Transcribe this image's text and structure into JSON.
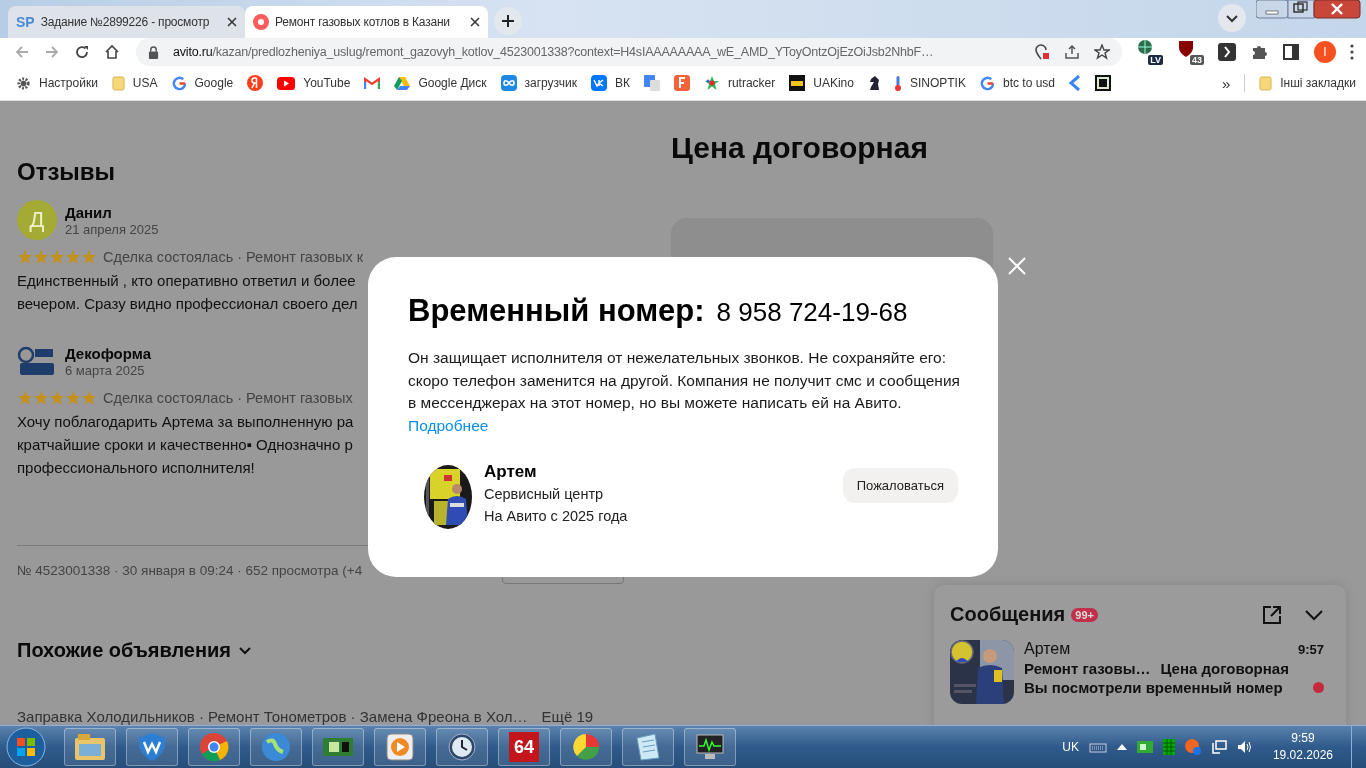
{
  "browser": {
    "tabs": [
      {
        "favicon_text": "SP",
        "title": "Задание №2899226 - просмотр",
        "selected": false
      },
      {
        "title": "Ремонт газовых котлов в Казани",
        "selected": true
      }
    ],
    "address": {
      "host": "avito.ru",
      "path": "/kazan/predlozheniya_uslug/remont_gazovyh_kotlov_4523001338?context=H4sIAAAAAAAA_wE_AMD_YToyOntzOjEzOiJsb2NhbF…"
    },
    "extensions": [
      {
        "kind": "globe",
        "badge": "LV"
      },
      {
        "kind": "shield",
        "badge": "43"
      },
      {
        "kind": "bracket"
      },
      {
        "kind": "puzzle"
      },
      {
        "kind": "sidebar"
      }
    ],
    "profile": "I",
    "bookmarks": [
      {
        "kind": "gear",
        "label": "Настройки"
      },
      {
        "kind": "folder",
        "label": "USA"
      },
      {
        "kind": "google",
        "label": "Google"
      },
      {
        "kind": "yandex"
      },
      {
        "kind": "youtube",
        "label": "YouTube"
      },
      {
        "kind": "gmail"
      },
      {
        "kind": "drive",
        "label": "Google Диск"
      },
      {
        "kind": "loop",
        "label": "загрузчик"
      },
      {
        "kind": "vk",
        "label": "ВК"
      },
      {
        "kind": "translate"
      },
      {
        "kind": "fbox"
      },
      {
        "kind": "star",
        "label": "rutracker"
      },
      {
        "kind": "film",
        "label": "UAKino"
      },
      {
        "kind": "knight"
      },
      {
        "kind": "thermometer",
        "label": "SINOPTIK"
      },
      {
        "kind": "google",
        "label": "btc to usd"
      },
      {
        "kind": "chevron"
      },
      {
        "kind": "square"
      }
    ],
    "more": "»",
    "other_bookmarks": "Інші закладки"
  },
  "page": {
    "reviews_title": "Отзывы",
    "reviews": [
      {
        "avatar_letter": "Д",
        "name": "Данил",
        "date": "21 апреля 2025",
        "stars": 5,
        "deal": "Сделка состоялась · Ремонт газовых к",
        "text": [
          "Единственный , кто оперативно ответил и более",
          "вечером. Сразу видно профессионал своего дел"
        ]
      },
      {
        "name": "Декоформа",
        "date": "6 марта 2025",
        "stars": 5,
        "deal": "Сделка состоялась · Ремонт газовых",
        "text": [
          "Хочу поблагодарить Артема за выполненную ра",
          "кратчайшие сроки и качественно▪ Однозначно р",
          "профессионального исполнителя!"
        ]
      }
    ],
    "meta": "№ 4523001338 · 30 января в 09:24 · 652 просмотра (+4",
    "similar_title": "Похожие объявления",
    "similar_links": "Заправка Холодильников · Ремонт Тонометров · Замена Фреона в Хол…",
    "similar_more": "Ещё 19",
    "price": "Цена договорная"
  },
  "modal": {
    "title": "Временный номер:",
    "phone": "8 958 724-19-68",
    "text": "Он защищает исполнителя от нежелательных звонков. Не сохраняйте его: скоро телефон заменится на другой. Компания не получит смс и сообщения в мессенджерах на этот номер, но вы можете написать ей на Авито.",
    "link": "Подробнее",
    "seller": {
      "name": "Артем",
      "type": "Сервисный центр",
      "since": "На Авито с 2025 года"
    },
    "report_button": "Пожаловаться"
  },
  "messages": {
    "title": "Сообщения",
    "badge": "99+",
    "chats": [
      {
        "name": "Артем",
        "time": "9:57",
        "item": "Ремонт газовы…",
        "price": "Цена договорная",
        "last": "Вы посмотрели временный номер",
        "unread": true
      }
    ]
  },
  "taskbar": {
    "apps": [
      {
        "kind": "explorer"
      },
      {
        "kind": "shield"
      },
      {
        "kind": "chrome"
      },
      {
        "kind": "globe"
      },
      {
        "kind": "chip"
      },
      {
        "kind": "player"
      },
      {
        "kind": "clock"
      },
      {
        "kind": "aida",
        "label": "64"
      },
      {
        "kind": "paint"
      },
      {
        "kind": "notes"
      },
      {
        "kind": "monitor"
      }
    ],
    "language": "UK",
    "time": "9:59",
    "date": "19.02.2026"
  }
}
